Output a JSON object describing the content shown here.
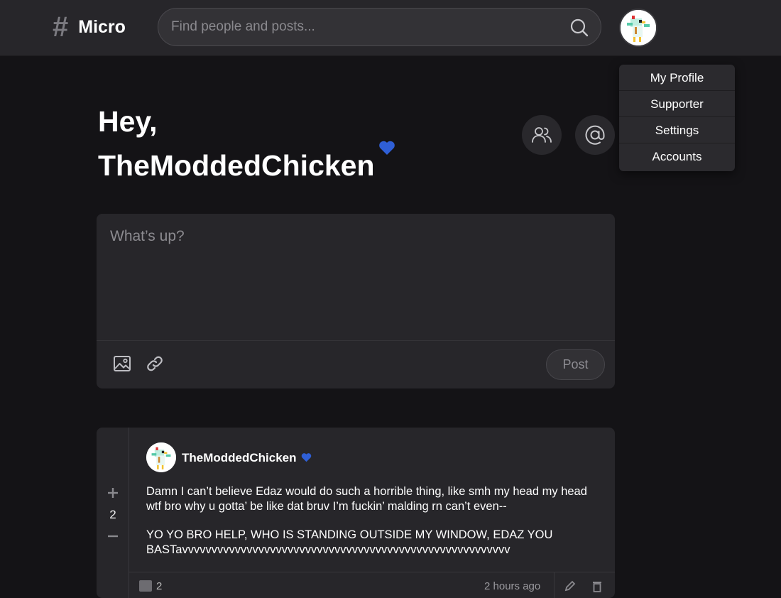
{
  "header": {
    "brand_symbol": "#",
    "brand_name": "Micro",
    "search_placeholder": "Find people and posts..."
  },
  "user_menu": {
    "items": [
      "My Profile",
      "Supporter",
      "Settings",
      "Accounts"
    ]
  },
  "greeting": {
    "line1": "Hey,",
    "username": "TheModdedChicken"
  },
  "composer": {
    "placeholder": "What’s up?",
    "post_label": "Post"
  },
  "post": {
    "author": "TheModdedChicken",
    "votes": "2",
    "paragraphs": [
      "Damn I can’t believe Edaz would do such a horrible thing, like smh my head my head wtf bro why u gotta’ be like dat bruv I’m fuckin’ malding rn can’t even--",
      "YO YO BRO HELP, WHO IS STANDING OUTSIDE MY WINDOW, EDAZ YOU BASTavvvvvvvvvvvvvvvvvvvvvvvvvvvvvvvvvvvvvvvvvvvvvvvvvvvvvvvv"
    ],
    "comment_count": "2",
    "time": "2 hours ago"
  },
  "colors": {
    "background": "#141316",
    "surface": "#27262a",
    "supporter_heart": "#2f5fd6"
  },
  "icons": [
    "search-icon",
    "people-icon",
    "at-icon",
    "image-icon",
    "link-icon",
    "plus-icon",
    "minus-icon",
    "comment-icon",
    "edit-icon",
    "delete-icon",
    "heart-icon"
  ]
}
